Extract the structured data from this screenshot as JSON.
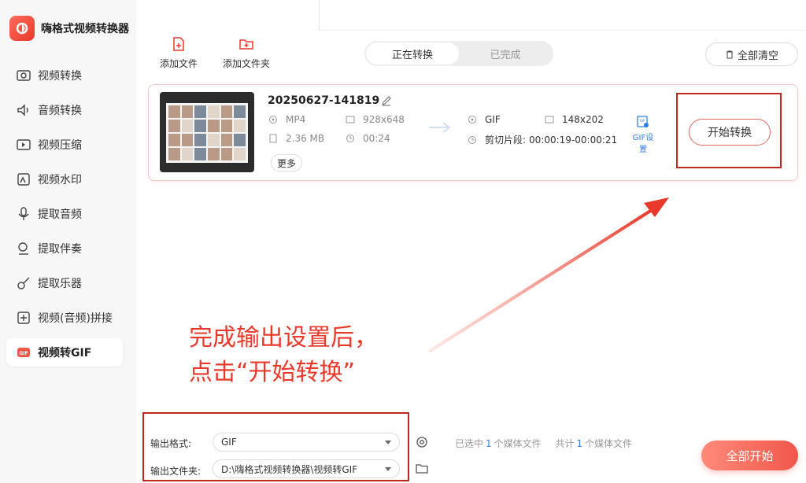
{
  "app": {
    "name": "嗨格式视频转换器"
  },
  "sidebar": {
    "items": [
      {
        "label": "视频转换",
        "icon": "video-convert-icon"
      },
      {
        "label": "音频转换",
        "icon": "audio-convert-icon"
      },
      {
        "label": "视频压缩",
        "icon": "video-compress-icon"
      },
      {
        "label": "视频水印",
        "icon": "video-watermark-icon"
      },
      {
        "label": "提取音频",
        "icon": "extract-audio-icon"
      },
      {
        "label": "提取伴奏",
        "icon": "extract-accompaniment-icon"
      },
      {
        "label": "提取乐器",
        "icon": "extract-instrument-icon"
      },
      {
        "label": "视频(音频)拼接",
        "icon": "merge-icon"
      },
      {
        "label": "视频转GIF",
        "icon": "gif-icon",
        "active": true
      }
    ]
  },
  "toolbar": {
    "add_file": "添加文件",
    "add_folder": "添加文件夹",
    "tabs": [
      {
        "label": "正在转换",
        "active": true
      },
      {
        "label": "已完成",
        "active": false
      }
    ],
    "clear_all": "全部清空"
  },
  "file": {
    "name": "20250627-141819",
    "src_format": "MP4",
    "src_resolution": "928x648",
    "src_size": "2.36 MB",
    "src_duration": "00:24",
    "more": "更多",
    "out_format": "GIF",
    "out_resolution": "148x202",
    "clip_label": "剪切片段:",
    "clip_range": "00:00:19-00:00:21",
    "gif_settings": "GIF设置",
    "start_button": "开始转换"
  },
  "annotation": {
    "line1": "完成输出设置后，",
    "line2": "点击“开始转换”"
  },
  "bottom": {
    "output_format_label": "输出格式:",
    "output_format_value": "GIF",
    "output_folder_label": "输出文件夹:",
    "output_folder_value": "D:\\嗨格式视频转换器\\视频转GIF",
    "selected_prefix": "已选中",
    "selected_count": "1",
    "selected_suffix": "个媒体文件",
    "total_prefix": "共计",
    "total_count": "1",
    "total_suffix": "个媒体文件",
    "start_all": "全部开始"
  },
  "colors": {
    "accent": "#e8392b",
    "link": "#2f7de1",
    "annotation": "#e8392b"
  }
}
